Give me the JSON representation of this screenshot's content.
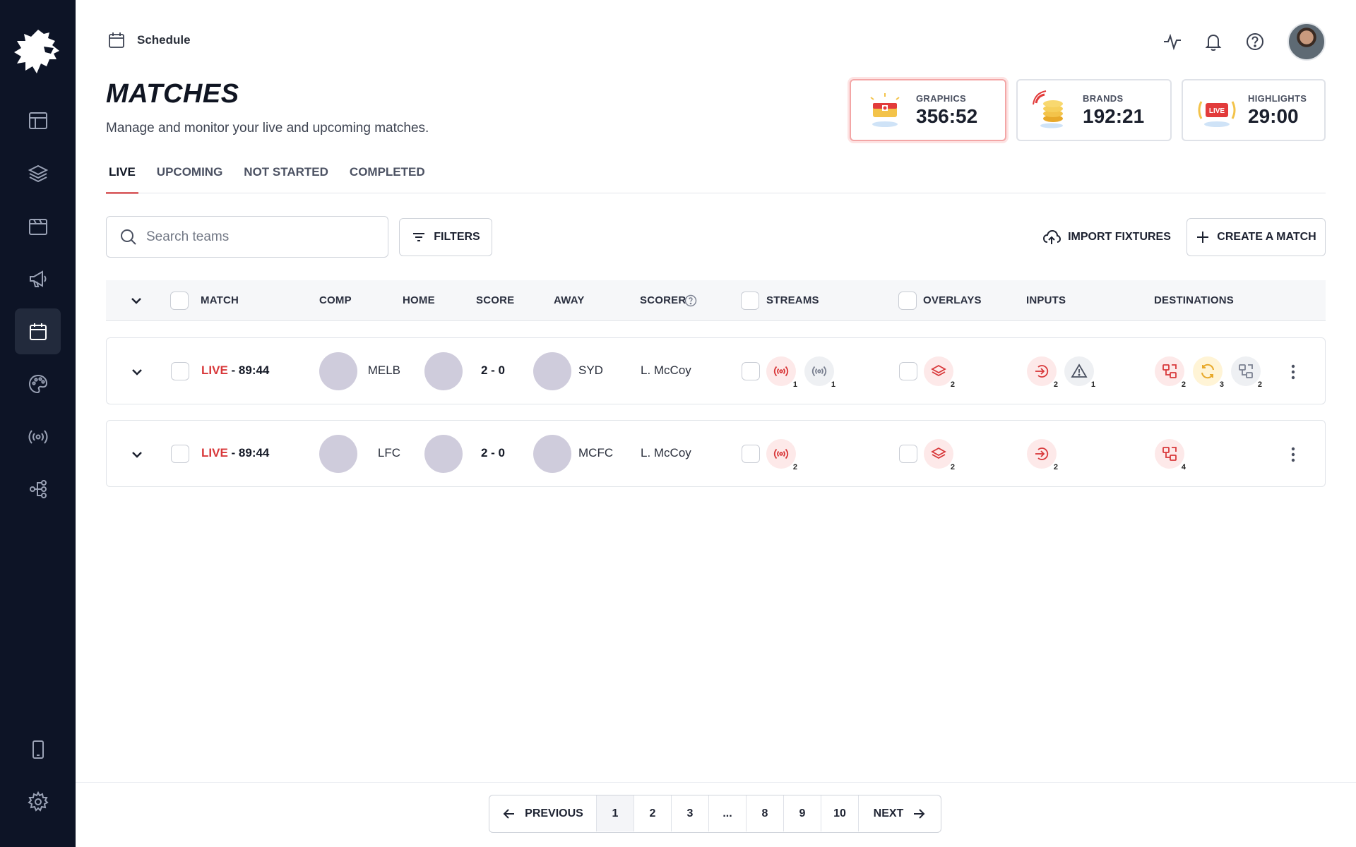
{
  "breadcrumb": {
    "label": "Schedule"
  },
  "page": {
    "title": "MATCHES",
    "subtitle": "Manage and monitor your live and upcoming matches."
  },
  "stats": [
    {
      "label": "GRAPHICS",
      "value": "356:52"
    },
    {
      "label": "BRANDS",
      "value": "192:21"
    },
    {
      "label": "HIGHLIGHTS",
      "value": "29:00",
      "badge": "LIVE"
    }
  ],
  "tabs": [
    "LIVE",
    "UPCOMING",
    "NOT STARTED",
    "COMPLETED"
  ],
  "search": {
    "placeholder": "Search teams",
    "value": ""
  },
  "buttons": {
    "filters": "FILTERS",
    "import": "IMPORT FIXTURES",
    "create": "CREATE A MATCH"
  },
  "table": {
    "headers": {
      "match": "MATCH",
      "comp": "COMP",
      "home": "HOME",
      "score": "SCORE",
      "away": "AWAY",
      "scorer": "SCORER",
      "streams": "STREAMS",
      "overlays": "OVERLAYS",
      "inputs": "INPUTS",
      "destinations": "DESTINATIONS"
    },
    "rows": [
      {
        "status": "LIVE",
        "clock": " - 89:44",
        "home": "MELB",
        "score": "2 - 0",
        "away": "SYD",
        "scorer": "L. McCoy",
        "streams": [
          "1",
          "1"
        ],
        "overlays": [
          "2"
        ],
        "inputs": [
          "2",
          "1"
        ],
        "destinations": [
          "2",
          "3",
          "2"
        ]
      },
      {
        "status": "LIVE",
        "clock": " - 89:44",
        "home": "LFC",
        "score": "2 - 0",
        "away": "MCFC",
        "scorer": "L. McCoy",
        "streams": [
          "2"
        ],
        "overlays": [
          "2"
        ],
        "inputs": [
          "2"
        ],
        "destinations": [
          "4"
        ]
      }
    ]
  },
  "pagination": {
    "previous": "PREVIOUS",
    "next": "NEXT",
    "pages": [
      "1",
      "2",
      "3",
      "...",
      "8",
      "9",
      "10"
    ],
    "current": "1"
  },
  "colors": {
    "sidebar": "#0d1426",
    "accent": "#d8383a",
    "crest": "#cfccdc"
  },
  "icons": {
    "sidebar": [
      "lion-logo",
      "layout-icon",
      "layers-icon",
      "media-icon",
      "megaphone-icon",
      "calendar-icon",
      "palette-icon",
      "broadcast-icon",
      "workflow-icon",
      "tablet-icon",
      "settings-icon"
    ],
    "topbar": [
      "activity-icon",
      "bell-icon",
      "help-icon"
    ]
  }
}
